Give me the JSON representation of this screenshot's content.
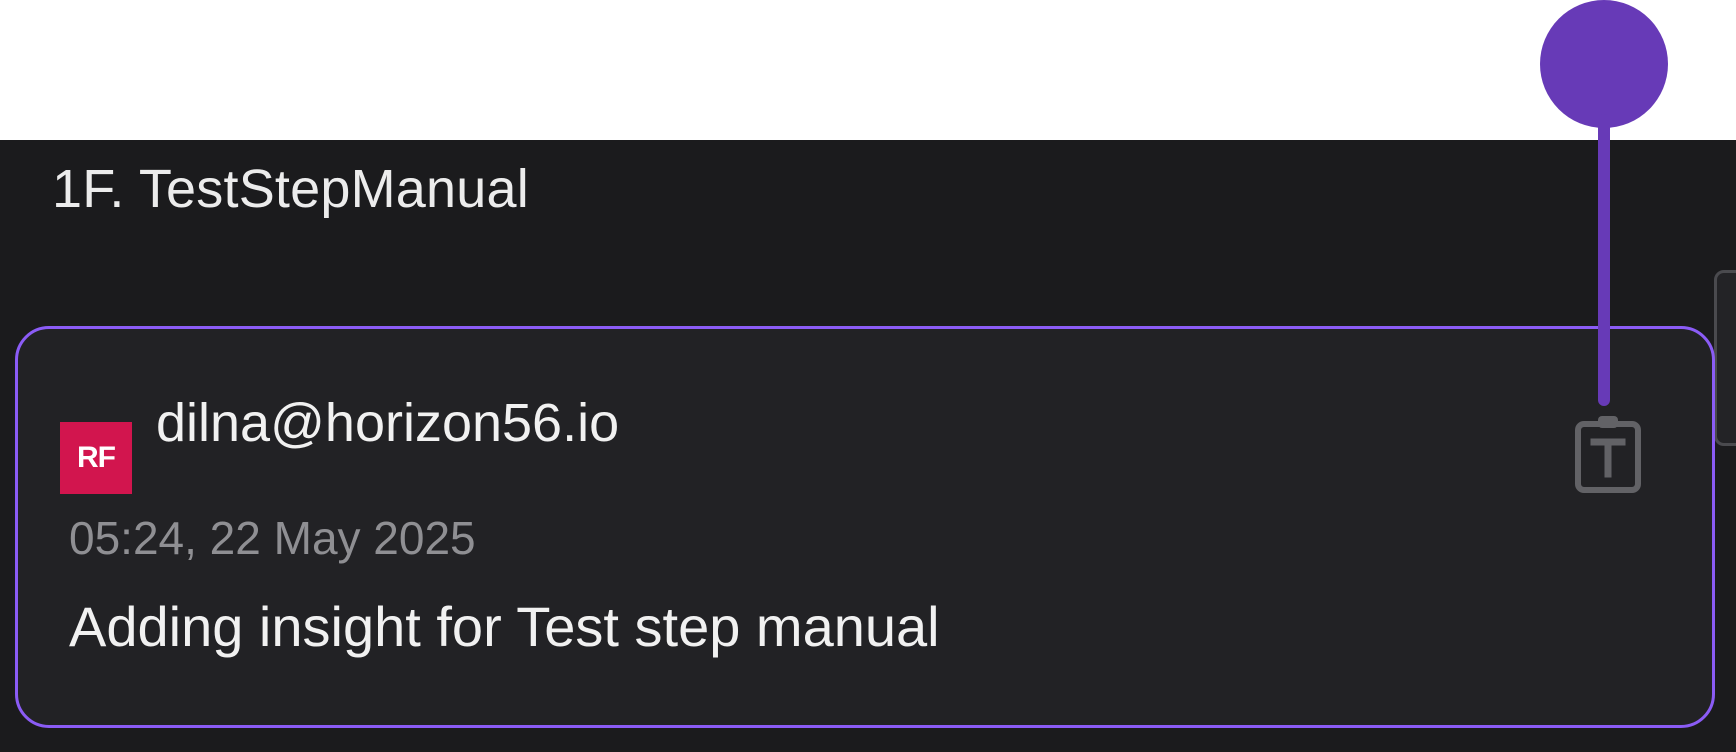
{
  "panel": {
    "title": "1F. TestStepManual"
  },
  "insight": {
    "avatar_text": "RF",
    "author": "dilna@horizon56.io",
    "timestamp": "05:24, 22 May 2025",
    "text": "Adding insight for Test step manual",
    "action_icon": "clipboard-text-icon"
  },
  "colors": {
    "panel_background": "#1b1b1d",
    "card_background": "#222225",
    "card_border": "#8b5cf6",
    "avatar_background": "#d2154e",
    "marker": "#673ab7",
    "muted_text": "#8f8f93",
    "icon": "#626266"
  }
}
